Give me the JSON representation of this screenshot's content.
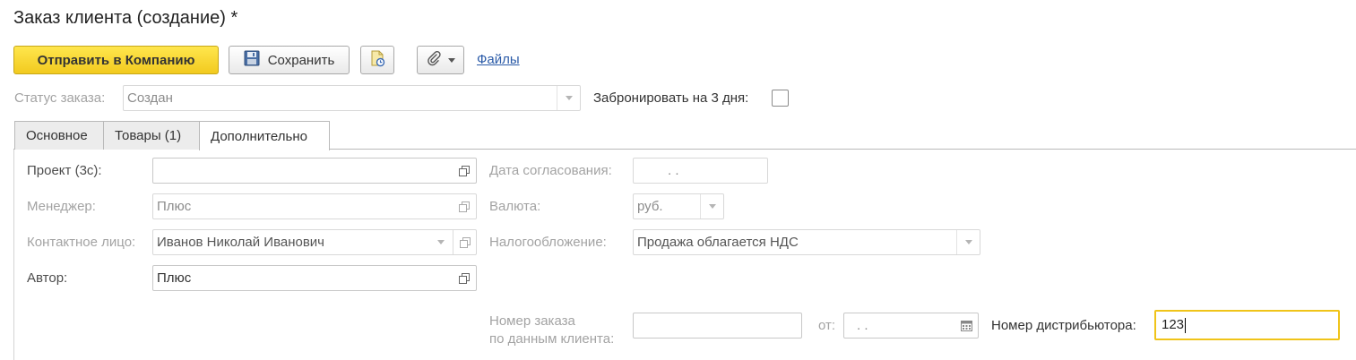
{
  "window": {
    "title": "Заказ клиента (создание) *"
  },
  "toolbar": {
    "send_label": "Отправить в Компанию",
    "save_label": "Сохранить",
    "files_label": "Файлы"
  },
  "status": {
    "label": "Статус заказа:",
    "value": "Создан",
    "reserve_label": "Забронировать на 3 дня:",
    "reserve_checked": false
  },
  "tabs": [
    {
      "label": "Основное",
      "active": false
    },
    {
      "label": "Товары (1)",
      "active": false
    },
    {
      "label": "Дополнительно",
      "active": true
    }
  ],
  "form": {
    "project": {
      "label": "Проект (3с):",
      "value": ""
    },
    "manager": {
      "label": "Менеджер:",
      "value": "Плюс"
    },
    "contact": {
      "label": "Контактное лицо:",
      "value": "Иванов Николай Иванович"
    },
    "author": {
      "label": "Автор:",
      "value": "Плюс"
    },
    "approval_date": {
      "label": "Дата согласования:",
      "value": ".  ."
    },
    "currency": {
      "label": "Валюта:",
      "value": "руб."
    },
    "taxation": {
      "label": "Налогообложение:",
      "value": "Продажа облагается НДС"
    },
    "client_order_number": {
      "label_line1": "Номер заказа",
      "label_line2": "по данным клиента:",
      "value": ""
    },
    "order_date": {
      "label": "от:",
      "value": ".  ."
    },
    "distributor_number": {
      "label": "Номер дистрибьютора:",
      "value": "123"
    }
  }
}
